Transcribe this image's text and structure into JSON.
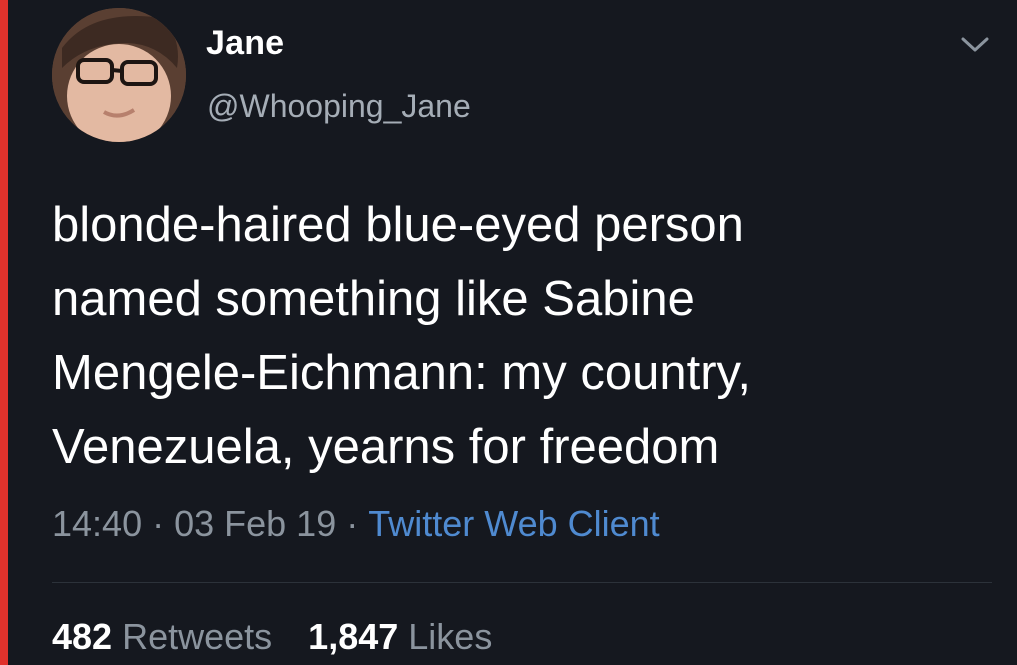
{
  "tweet": {
    "display_name": "Jane",
    "handle": "@Whooping_Jane",
    "text_lines": [
      "blonde-haired blue-eyed person",
      "named something like Sabine",
      "Mengele-Eichmann: my country,",
      "Venezuela, yearns for freedom"
    ],
    "time": "14:40",
    "date": "03 Feb 19",
    "separator": "·",
    "client": "Twitter Web Client",
    "retweets_count": "482",
    "retweets_label": "Retweets",
    "likes_count": "1,847",
    "likes_label": "Likes"
  },
  "icons": {
    "menu": "chevron-down-icon",
    "avatar": "avatar"
  },
  "colors": {
    "background": "#15181f",
    "text_primary": "#ffffff",
    "text_secondary": "#8b949e",
    "link": "#4f8ad0",
    "edge_bar": "#e0322c"
  }
}
